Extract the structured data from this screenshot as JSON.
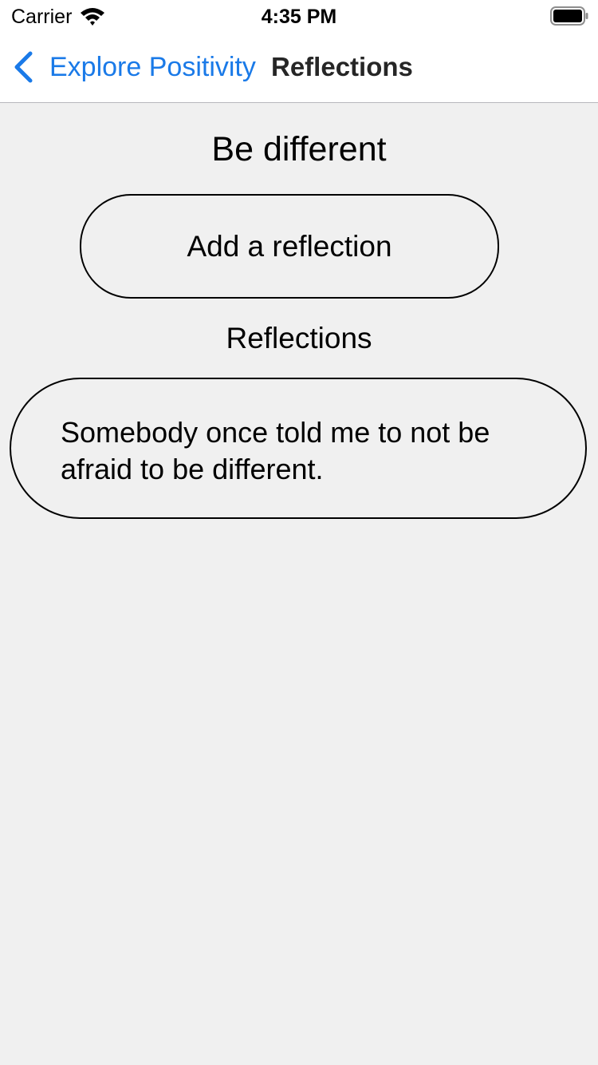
{
  "status_bar": {
    "carrier": "Carrier",
    "time": "4:35 PM"
  },
  "nav": {
    "back_label": "Explore Positivity",
    "title": "Reflections",
    "accent_color": "#1a7ae8"
  },
  "main": {
    "title": "Be different",
    "add_button_label": "Add a reflection",
    "section_title": "Reflections",
    "reflections": [
      {
        "text": "Somebody once told me to not be afraid to be different."
      }
    ]
  }
}
